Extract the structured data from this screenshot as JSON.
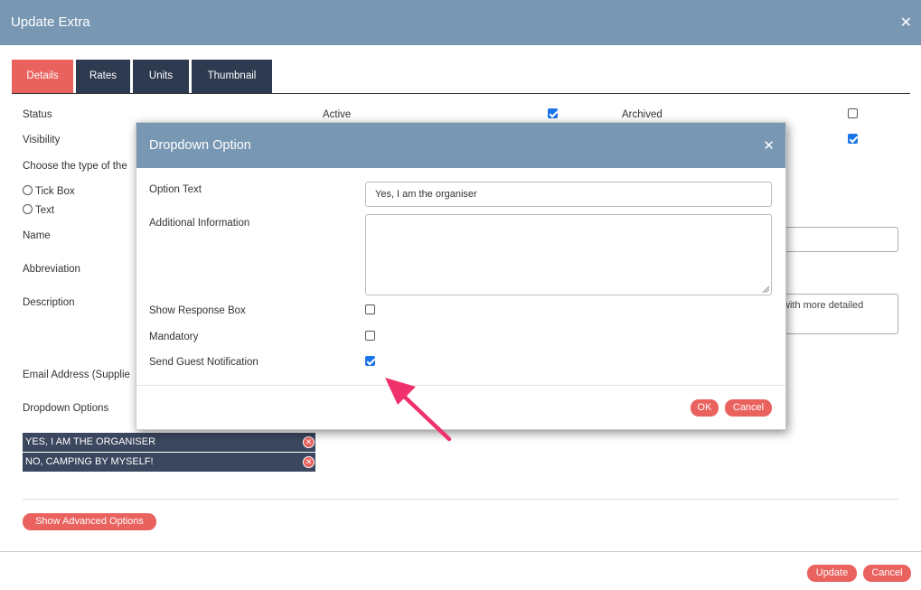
{
  "window": {
    "title": "Update Extra",
    "close_icon": "close-icon"
  },
  "tabs": [
    {
      "label": "Details",
      "active": true
    },
    {
      "label": "Rates",
      "active": false
    },
    {
      "label": "Units",
      "active": false
    },
    {
      "label": "Thumbnail",
      "active": false
    }
  ],
  "form": {
    "status_label": "Status",
    "active_label": "Active",
    "active_checked": true,
    "archived_label": "Archived",
    "archived_checked": false,
    "visibility_label": "Visibility",
    "visibility_checked": true,
    "type_label": "Choose the type of the",
    "type_options": [
      {
        "label": "Tick Box"
      },
      {
        "label": "Text"
      }
    ],
    "name_label": "Name",
    "abbreviation_label": "Abbreviation",
    "description_label": "Description",
    "description_visible_text": "with more detailed",
    "email_label": "Email Address (Supplie",
    "dropdown_label": "Dropdown Options",
    "dropdown_options": [
      {
        "text": "YES, I AM THE ORGANISER"
      },
      {
        "text": "NO, CAMPING BY MYSELF!"
      }
    ],
    "advanced_button": "Show Advanced Options"
  },
  "footer": {
    "update_label": "Update",
    "cancel_label": "Cancel"
  },
  "modal": {
    "title": "Dropdown Option",
    "option_text_label": "Option Text",
    "option_text_value": "Yes, I am the organiser",
    "additional_info_label": "Additional Information",
    "additional_info_value": "",
    "show_response_label": "Show Response Box",
    "show_response_checked": false,
    "mandatory_label": "Mandatory",
    "mandatory_checked": false,
    "send_notification_label": "Send Guest Notification",
    "send_notification_checked": true,
    "ok_label": "OK",
    "cancel_label": "Cancel"
  },
  "colors": {
    "header": "#7897b3",
    "accent": "#e9625e",
    "tab_dark": "#2d3a50",
    "arrow": "#f0316b",
    "checkbox": "#1a73e8"
  }
}
